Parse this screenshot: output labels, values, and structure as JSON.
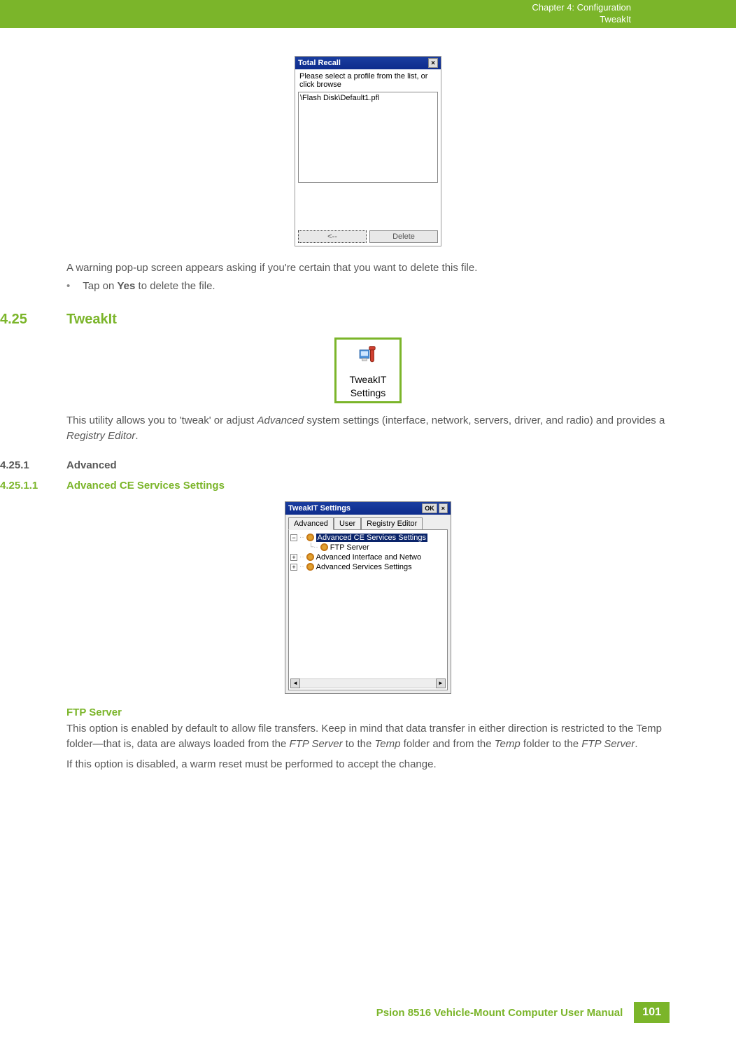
{
  "header": {
    "chapter_line": "Chapter 4: Configuration",
    "section_line": "TweakIt"
  },
  "dialog1": {
    "title": "Total Recall",
    "prompt": "Please select a profile from the list, or click browse",
    "list_item": "\\Flash Disk\\Default1.pfl",
    "back_btn": "<--",
    "delete_btn": "Delete"
  },
  "para1": "A warning pop-up screen appears asking if you're certain that you want to delete this file.",
  "bullet1_pre": "Tap on ",
  "bullet1_bold": "Yes",
  "bullet1_post": " to delete the file.",
  "sec_425_num": "4.25",
  "sec_425_title": "TweakIt",
  "tweakit_icon_label1": "TweakIT",
  "tweakit_icon_label2": "Settings",
  "para2_pre": "This utility allows you to 'tweak' or adjust ",
  "para2_i1": "Advanced",
  "para2_mid": " system settings (interface, network, servers, driver, and radio) and provides a ",
  "para2_i2": "Registry Editor",
  "para2_post": ".",
  "sec_4251_num": "4.25.1",
  "sec_4251_title": "Advanced",
  "sec_42511_num": "4.25.1.1",
  "sec_42511_title": "Advanced CE Services Settings",
  "dialog2": {
    "title": "TweakIT Settings",
    "ok": "OK",
    "tabs": {
      "t1": "Advanced",
      "t2": "User",
      "t3": "Registry Editor"
    },
    "tree": {
      "n1": "Advanced CE Services Settings",
      "n1a": "FTP Server",
      "n2": "Advanced Interface and Netwo",
      "n3": "Advanced Services Settings"
    }
  },
  "ftp_heading": "FTP Server",
  "ftp_p1_pre": "This option is enabled by default to allow file transfers. Keep in mind that data transfer in either direction is restricted to the Temp folder—that is, data are always loaded from the ",
  "ftp_i1": "FTP Server",
  "ftp_m1": " to the ",
  "ftp_i2": "Temp",
  "ftp_m2": " folder and from the ",
  "ftp_i3": "Temp",
  "ftp_m3": " folder to the ",
  "ftp_i4": "FTP Server",
  "ftp_p1_post": ".",
  "ftp_p2": "If this option is disabled, a warm reset must be performed to accept the change.",
  "footer": {
    "text": "Psion 8516 Vehicle-Mount Computer User Manual",
    "page": "101"
  }
}
